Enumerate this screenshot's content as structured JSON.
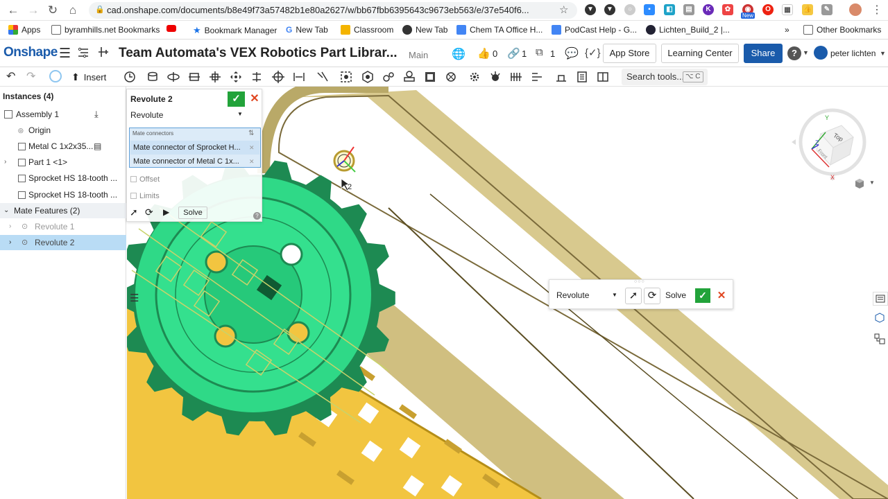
{
  "browser": {
    "url": "cad.onshape.com/documents/b8e49f73a57482b1e80a2627/w/bb67fbb6395643c9673eb563/e/37e540f6...",
    "bookmarks": [
      {
        "label": "Apps"
      },
      {
        "label": "byramhills.net Bookmarks"
      },
      {
        "label": ""
      },
      {
        "label": "Bookmark Manager"
      },
      {
        "label": "New Tab"
      },
      {
        "label": "Classroom"
      },
      {
        "label": "New Tab"
      },
      {
        "label": "Chem TA Office H..."
      },
      {
        "label": "PodCast Help - G..."
      },
      {
        "label": "Lichten_Build_2 |..."
      }
    ],
    "more_bookmarks": "»",
    "other_bookmarks": "Other Bookmarks",
    "ext_badge": "New"
  },
  "header": {
    "logo": "Onshape",
    "title": "Team Automata's VEX Robotics Part Librar...",
    "branch": "Main",
    "likes": "0",
    "links": "1",
    "copies": "1",
    "app_store": "App Store",
    "learning_center": "Learning Center",
    "share": "Share",
    "user": "peter lichten"
  },
  "toolbar": {
    "insert": "Insert",
    "search_placeholder": "Search tools...",
    "shortcut": "⌥ C"
  },
  "left_panel": {
    "instances_title": "Instances (4)",
    "items": [
      {
        "label": "Assembly 1"
      },
      {
        "label": "Origin"
      },
      {
        "label": "Metal C 1x2x35..."
      },
      {
        "label": "Part 1 <1>"
      },
      {
        "label": "Sprocket HS 18-tooth ..."
      },
      {
        "label": "Sprocket HS 18-tooth ..."
      }
    ],
    "mate_features_title": "Mate Features (2)",
    "mates": [
      {
        "label": "Revolute 1"
      },
      {
        "label": "Revolute 2"
      }
    ]
  },
  "feature_dialog": {
    "title": "Revolute 2",
    "type": "Revolute",
    "mate_connectors_label": "Mate connectors",
    "connectors": [
      "Mate connector of Sprocket H...",
      "Mate connector of Metal C 1x..."
    ],
    "offset_label": "Offset",
    "limits_label": "Limits",
    "solve_label": "Solve",
    "help": "?"
  },
  "mini_dialog": {
    "type": "Revolute",
    "solve_label": "Solve",
    "grip": "○○○"
  },
  "viewport": {
    "cursor_count": "2",
    "view_cube": {
      "top": "Top",
      "front": "Front",
      "x": "X",
      "y": "Y",
      "z": "Z"
    }
  },
  "colors": {
    "brand": "#1a5bab",
    "sprocket": "#2fd987",
    "c_channel": "#f2c540",
    "rail": "#d8c98e",
    "confirm": "#22a33a",
    "cancel": "#e0451f"
  }
}
